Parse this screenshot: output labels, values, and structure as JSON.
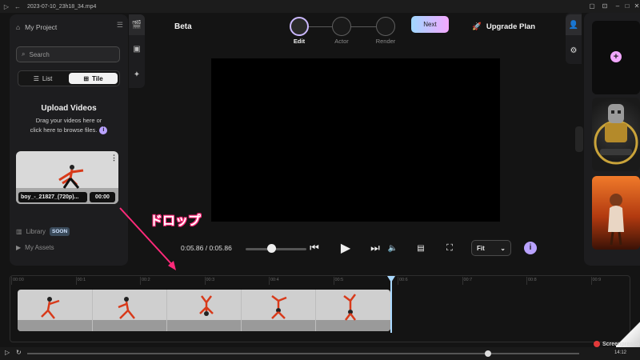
{
  "window": {
    "title": "2023-07-10_23h18_34.mp4",
    "bottom_time": "14:12",
    "watermark": "Screenpresso"
  },
  "sidebar": {
    "header": "My Project",
    "search_placeholder": "Search",
    "view_list": "List",
    "view_tile": "Tile",
    "upload_title": "Upload Videos",
    "upload_line1": "Drag your videos here or",
    "upload_line2": "click here to browse files.",
    "video": {
      "name": "boy_-_21827_(720p)...",
      "duration": "00:00"
    },
    "library_label": "Library",
    "library_badge": "SOON",
    "assets_label": "My Assets"
  },
  "header": {
    "brand": "Beta",
    "steps": [
      {
        "label": "Edit",
        "active": true
      },
      {
        "label": "Actor",
        "active": false
      },
      {
        "label": "Render",
        "active": false
      }
    ],
    "next_label": "Next",
    "upgrade_label": "Upgrade Plan"
  },
  "player": {
    "time": "0:05.86 / 0:05.86",
    "fit_label": "Fit",
    "info_glyph": "i"
  },
  "timeline": {
    "ticks": [
      "00:00",
      "00:1",
      "00:2",
      "00:3",
      "00:4",
      "00:5",
      "00:6",
      "00:7",
      "00:8",
      "00:9"
    ]
  },
  "annotation": {
    "text": "ドロップ",
    "color": "#ff2a7a"
  },
  "colors": {
    "accent": "#b9a2ff",
    "next_gradient_start": "#9fd8ff",
    "next_gradient_end": "#f4a7ff",
    "playhead": "#a9d8ff"
  }
}
